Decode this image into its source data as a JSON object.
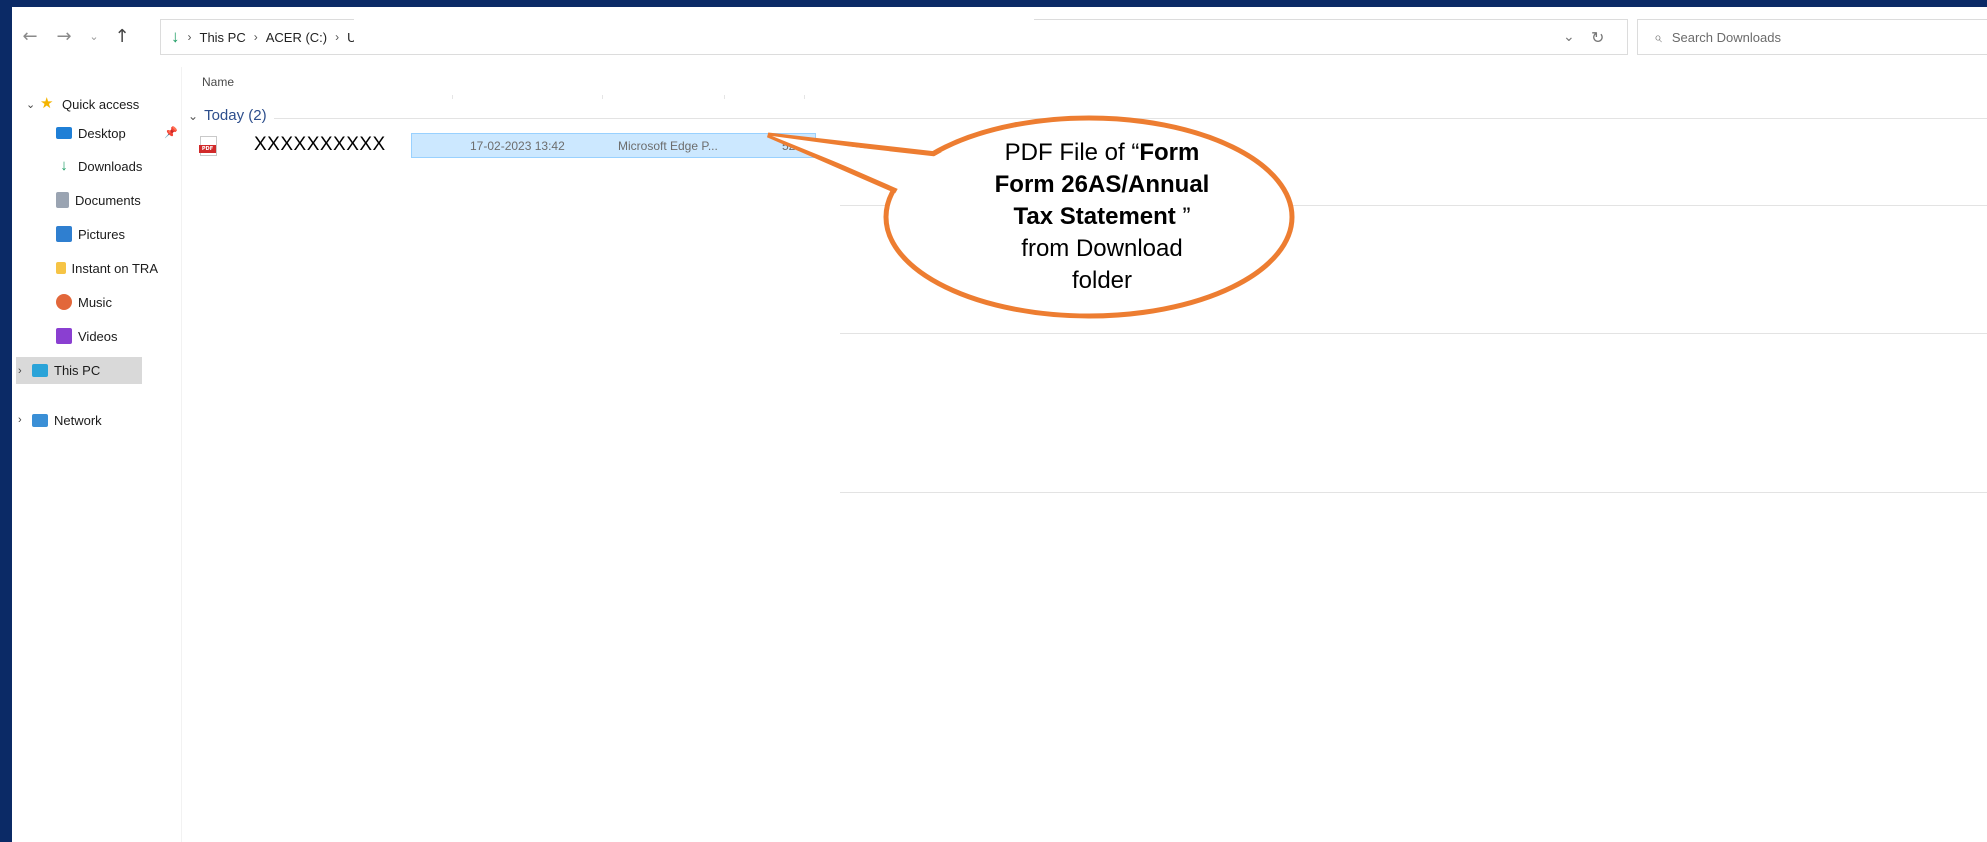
{
  "nav": {
    "back": "←",
    "forward": "→",
    "recent": "⌄",
    "up": "↑"
  },
  "address": {
    "icon": "↓",
    "crumbs": [
      "This PC",
      "ACER (C:)",
      "U"
    ],
    "separator": "›",
    "dropdown": "⌄",
    "refresh": "↻"
  },
  "search": {
    "placeholder": "Search Downloads"
  },
  "sidebar": {
    "quick_access": "Quick access",
    "items": [
      {
        "label": "Desktop"
      },
      {
        "label": "Downloads"
      },
      {
        "label": "Documents"
      },
      {
        "label": "Pictures"
      },
      {
        "label": "Instant on TRA"
      },
      {
        "label": "Music"
      },
      {
        "label": "Videos"
      }
    ],
    "this_pc": "This PC",
    "network": "Network"
  },
  "columns": {
    "name": "Name"
  },
  "group": {
    "label": "Today (2)"
  },
  "file": {
    "name": "XXXXXXXXXX",
    "date": "17-02-2023 13:42",
    "type": "Microsoft Edge P...",
    "size": "52 K"
  },
  "callout": {
    "line1_prefix": "PDF File of “",
    "line1_bold": "Form",
    "line2_bold": "Form 26AS/Annual",
    "line3_bold": "Tax Statement",
    "line3_suffix": " ”",
    "line4": "from Download",
    "line5": "folder"
  },
  "colors": {
    "accent": "#ed7d31",
    "frame": "#0b2a66",
    "selection": "#cce8ff"
  }
}
